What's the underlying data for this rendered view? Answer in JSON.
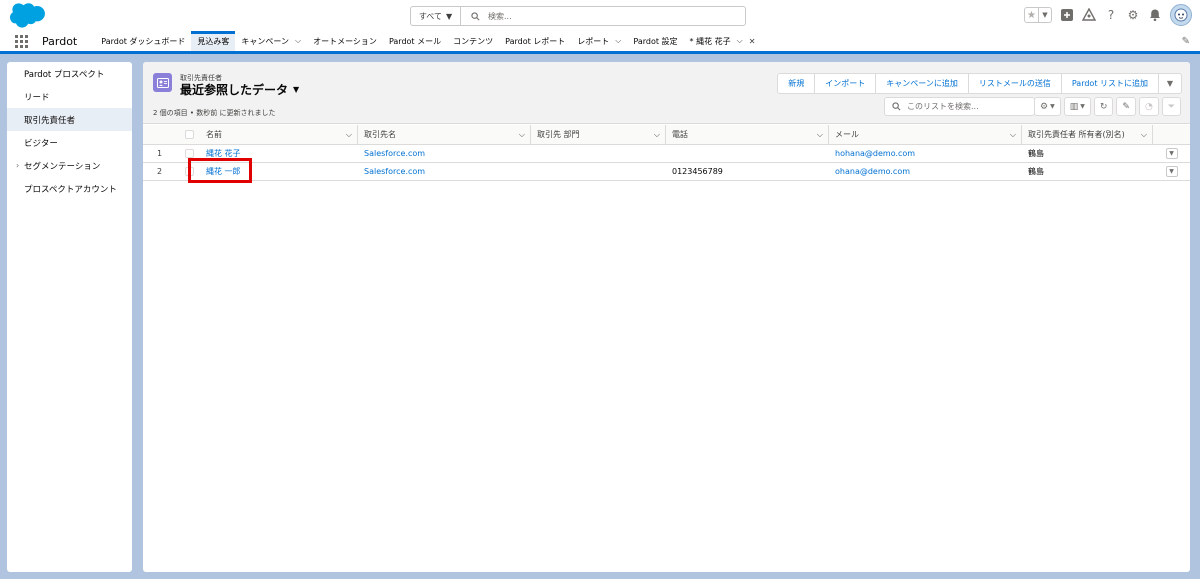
{
  "header": {
    "search_scope": "すべて",
    "search_placeholder": "検索..."
  },
  "nav": {
    "app_name": "Pardot",
    "items": [
      {
        "label": "Pardot ダッシュボード",
        "chevron": false
      },
      {
        "label": "見込み客",
        "chevron": false,
        "active": true
      },
      {
        "label": "キャンペーン",
        "chevron": true
      },
      {
        "label": "オートメーション",
        "chevron": false
      },
      {
        "label": "Pardot メール",
        "chevron": false
      },
      {
        "label": "コンテンツ",
        "chevron": false
      },
      {
        "label": "Pardot レポート",
        "chevron": false
      },
      {
        "label": "レポート",
        "chevron": true
      },
      {
        "label": "Pardot 設定",
        "chevron": false
      },
      {
        "label": "* 縄花 花子",
        "chevron": true,
        "closable": true
      }
    ]
  },
  "sidebar": {
    "items": [
      {
        "label": "Pardot プロスペクト"
      },
      {
        "label": "リード"
      },
      {
        "label": "取引先責任者",
        "selected": true
      },
      {
        "label": "ビジター"
      },
      {
        "label": "セグメンテーション",
        "expandable": true
      },
      {
        "label": "プロスペクトアカウント"
      }
    ]
  },
  "list_view": {
    "object_label": "取引先責任者",
    "title": "最近参照したデータ",
    "meta": "2 個の項目 • 数秒前 に更新されました",
    "actions": [
      "新規",
      "インポート",
      "キャンペーンに追加",
      "リストメールの送信",
      "Pardot リストに追加"
    ],
    "search_placeholder": "このリストを検索...",
    "columns": [
      "名前",
      "取引先名",
      "取引先 部門",
      "電話",
      "メール",
      "取引先責任者 所有者(別名)"
    ],
    "rows": [
      {
        "num": "1",
        "name": "縄花 花子",
        "account": "Salesforce.com",
        "dept": "",
        "phone": "",
        "email": "hohana@demo.com",
        "owner": "鶴島"
      },
      {
        "num": "2",
        "name": "縄花 一郎",
        "account": "Salesforce.com",
        "dept": "",
        "phone": "0123456789",
        "email": "ohana@demo.com",
        "owner": "鶴島"
      }
    ]
  },
  "colors": {
    "brand_blue": "#0070d2",
    "background": "#b0c4df",
    "highlight": "#e00000",
    "contact_icon": "#8b80d9"
  }
}
